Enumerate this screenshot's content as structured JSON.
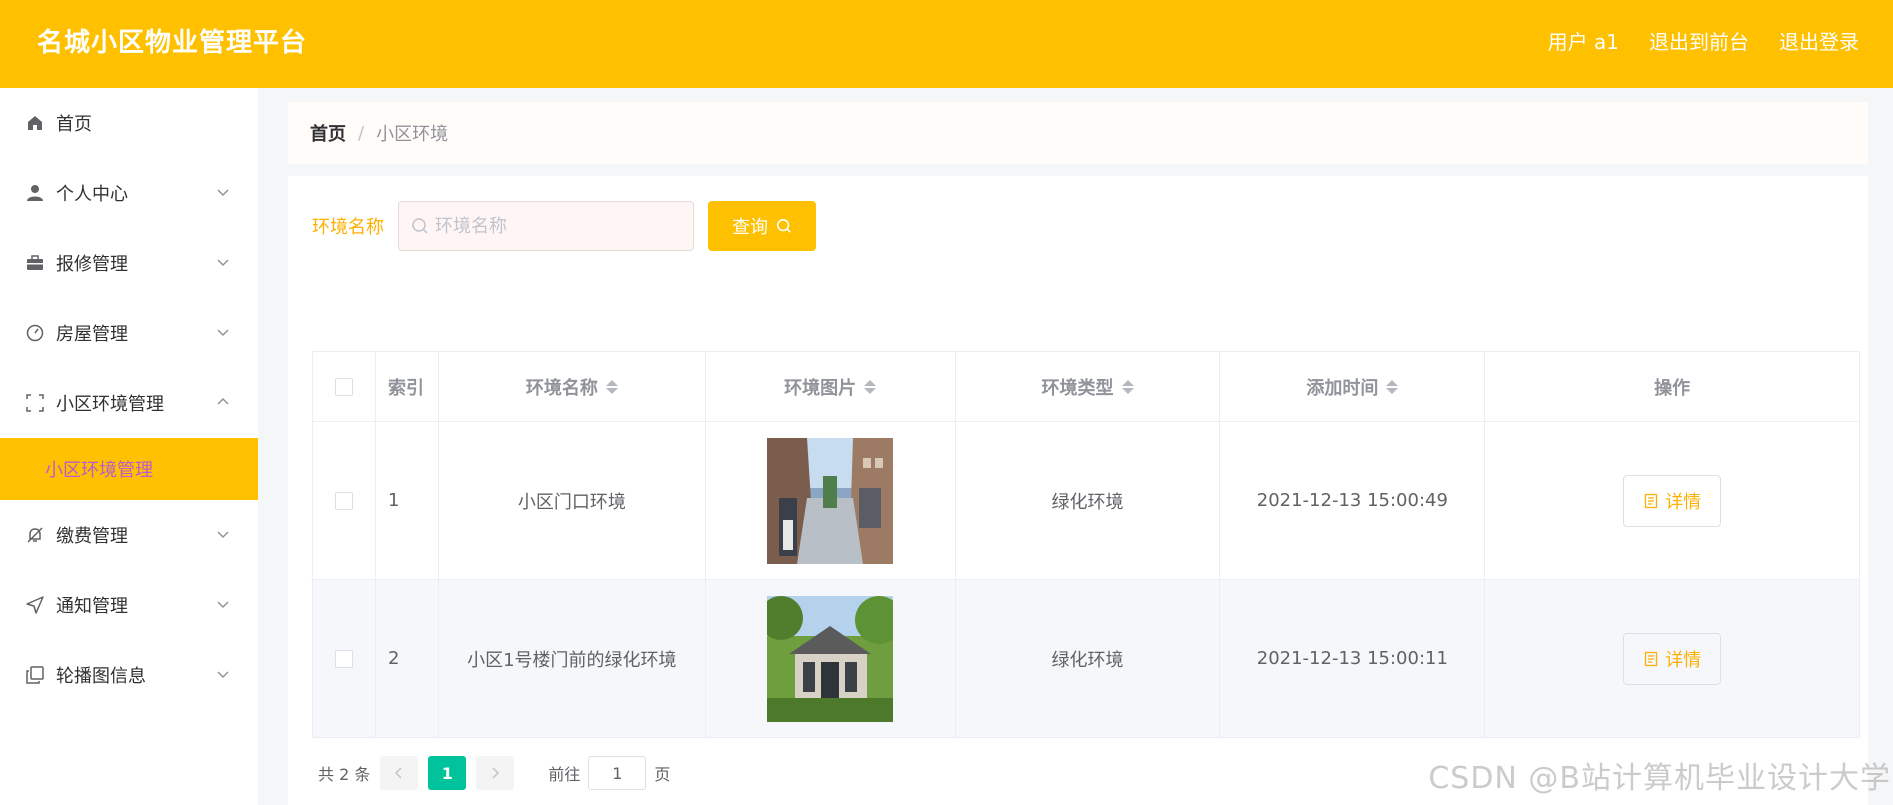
{
  "header": {
    "title": "名城小区物业管理平台",
    "user_label": "用户 a1",
    "exit_front_label": "退出到前台",
    "logout_label": "退出登录"
  },
  "sidebar": {
    "items": [
      {
        "label": "首页",
        "icon": "home-icon"
      },
      {
        "label": "个人中心",
        "icon": "user-icon"
      },
      {
        "label": "报修管理",
        "icon": "briefcase-icon"
      },
      {
        "label": "房屋管理",
        "icon": "gauge-icon"
      },
      {
        "label": "小区环境管理",
        "icon": "fullscreen-icon",
        "expanded": true
      },
      {
        "label": "缴费管理",
        "icon": "bell-off-icon"
      },
      {
        "label": "通知管理",
        "icon": "send-icon"
      },
      {
        "label": "轮播图信息",
        "icon": "copy-icon"
      }
    ],
    "active_submenu": "小区环境管理"
  },
  "breadcrumb": {
    "home": "首页",
    "separator": "/",
    "current": "小区环境"
  },
  "search": {
    "label": "环境名称",
    "placeholder": "环境名称",
    "button_label": "查询"
  },
  "table": {
    "columns": [
      "索引",
      "环境名称",
      "环境图片",
      "环境类型",
      "添加时间",
      "操作"
    ],
    "rows": [
      {
        "index": "1",
        "name": "小区门口环境",
        "image": "street-entrance-photo",
        "type": "绿化环境",
        "time": "2021-12-13 15:00:49",
        "action": "详情"
      },
      {
        "index": "2",
        "name": "小区1号楼门前的绿化环境",
        "image": "green-house-photo",
        "type": "绿化环境",
        "time": "2021-12-13 15:00:11",
        "action": "详情"
      }
    ]
  },
  "pagination": {
    "total_label": "共 2 条",
    "current_page": "1",
    "goto_label": "前往",
    "goto_value": "1",
    "page_suffix": "页"
  },
  "watermark": "CSDN @B站计算机毕业设计大学",
  "colors": {
    "brand": "#ffc000",
    "pager_active": "#00c39c",
    "submenu_text": "#b85ccf"
  }
}
